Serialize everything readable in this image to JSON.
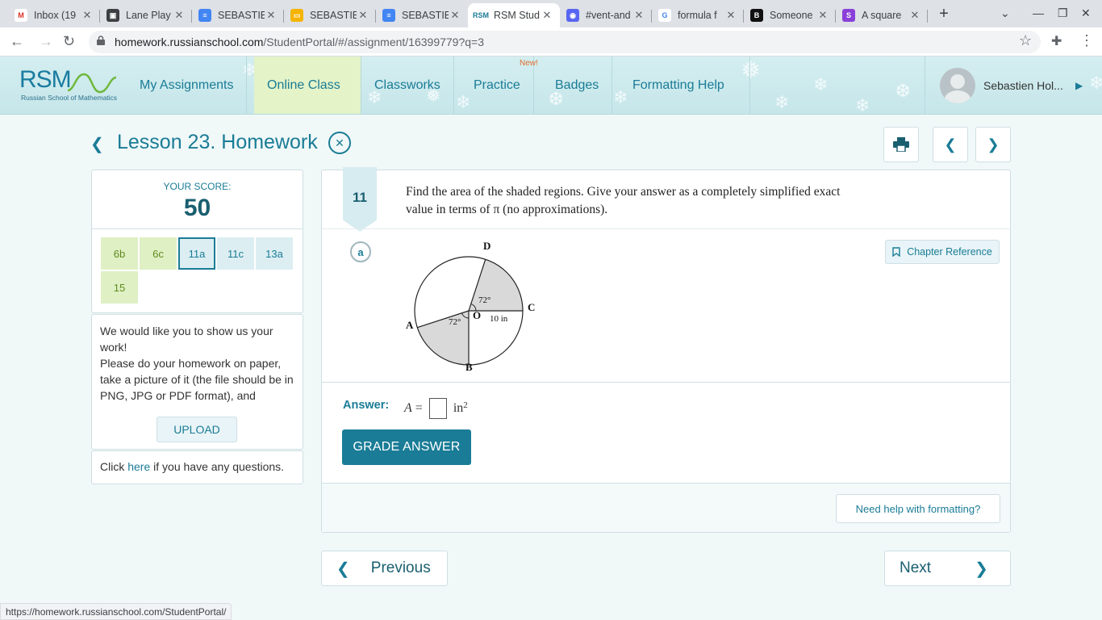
{
  "browser": {
    "tabs": [
      {
        "label": "Inbox (19",
        "fav_color": "#ffffff",
        "fav_text": "M",
        "fav_text_color": "#d93025"
      },
      {
        "label": "Lane Play",
        "fav_color": "#3c4043",
        "fav_text": "▣",
        "fav_text_color": "#ffffff"
      },
      {
        "label": "SEBASTIE",
        "fav_color": "#4285f4",
        "fav_text": "≡",
        "fav_text_color": "#ffffff"
      },
      {
        "label": "SEBASTIE",
        "fav_color": "#f4b400",
        "fav_text": "▭",
        "fav_text_color": "#ffffff"
      },
      {
        "label": "SEBASTIE",
        "fav_color": "#4285f4",
        "fav_text": "≡",
        "fav_text_color": "#ffffff"
      },
      {
        "label": "RSM Stud",
        "fav_color": "#ffffff",
        "fav_text": "RSM",
        "fav_text_color": "#1a7c96"
      },
      {
        "label": "#vent-and",
        "fav_color": "#5865f2",
        "fav_text": "◉",
        "fav_text_color": "#ffffff"
      },
      {
        "label": "formula f",
        "fav_color": "#ffffff",
        "fav_text": "G",
        "fav_text_color": "#4285f4"
      },
      {
        "label": "Someone",
        "fav_color": "#111111",
        "fav_text": "B",
        "fav_text_color": "#ffffff"
      },
      {
        "label": "A square",
        "fav_color": "#8b3fd9",
        "fav_text": "S",
        "fav_text_color": "#ffffff"
      }
    ],
    "url_host": "homework.russianschool.com",
    "url_path": "/StudentPortal/#/assignment/16399779?q=3",
    "status_url": "https://homework.russianschool.com/StudentPortal/"
  },
  "header": {
    "logo_text": "RSM",
    "logo_sub": "Russian School of Mathematics",
    "nav": [
      "My Assignments",
      "Online Class",
      "Classworks",
      "Practice",
      "Badges",
      "Formatting Help"
    ],
    "new_badge": "New!",
    "user_name": "Sebastien Hol..."
  },
  "lesson": {
    "title": "Lesson 23. Homework"
  },
  "score": {
    "label": "YOUR SCORE:",
    "value": "50",
    "questions": [
      {
        "label": "6b",
        "state": "green"
      },
      {
        "label": "6c",
        "state": "green"
      },
      {
        "label": "11a",
        "state": "current"
      },
      {
        "label": "11c",
        "state": "blue"
      },
      {
        "label": "13a",
        "state": "blue"
      },
      {
        "label": "15",
        "state": "green"
      }
    ]
  },
  "work": {
    "line1": "We would like you to show us your work!",
    "line2": "Please do your homework on paper, take a picture of it (the file should be in PNG, JPG or PDF format), and",
    "upload_label": "UPLOAD"
  },
  "questions_box": {
    "prefix": "Click ",
    "link": "here",
    "suffix": " if you have any questions."
  },
  "problem": {
    "number": "11",
    "prompt": "Find the area of the shaded regions. Give your answer as a completely simplified exact value  in terms of π (no approximations).",
    "part": "a",
    "chapter_ref": "Chapter Reference",
    "figure": {
      "label_d": "D",
      "label_c": "C",
      "label_a": "A",
      "label_b": "B",
      "label_o": "O",
      "angle_top": "72°",
      "angle_bottom": "72°",
      "radius": "10 in"
    },
    "answer_label": "Answer:",
    "answer_var": "A",
    "answer_eq": "=",
    "answer_unit": "in",
    "answer_exp": "2",
    "grade_label": "GRADE ANSWER",
    "help_label": "Need help with formatting?"
  },
  "pager": {
    "prev": "Previous",
    "next": "Next"
  }
}
